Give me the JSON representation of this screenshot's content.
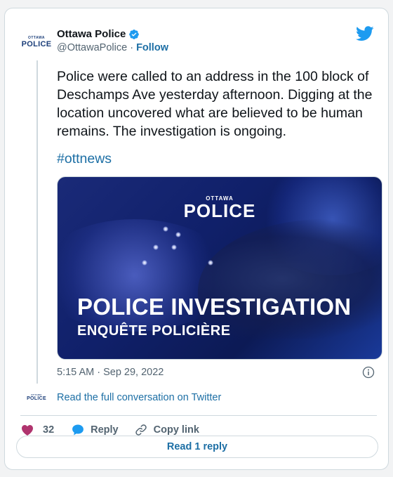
{
  "author": {
    "name": "Ottawa Police",
    "handle": "@OttawaPolice",
    "separator": "·",
    "follow_label": "Follow",
    "logo_small": "OTTAWA",
    "logo_main": "POLICE"
  },
  "tweet": {
    "text": "Police were called to an address in the 100 block of Deschamps Ave yesterday afternoon. Digging at the location uncovered what are believed to be human remains. The investigation is ongoing.",
    "hashtag": "#ottnews",
    "timestamp": "5:15 AM · Sep 29, 2022"
  },
  "media": {
    "logo_small": "OTTAWA",
    "logo_main": "POLICE",
    "title": "POLICE INVESTIGATION",
    "subtitle": "ENQUÊTE POLICIÈRE"
  },
  "conversation": {
    "link_text": "Read the full conversation on Twitter"
  },
  "actions": {
    "like_count": "32",
    "reply_label": "Reply",
    "copy_label": "Copy link"
  },
  "footer": {
    "read_replies_label": "Read 1 reply"
  },
  "colors": {
    "accent": "#1d6fa5",
    "heart": "#b0346e",
    "verified": "#1d9bf0",
    "twitter": "#1d9bf0"
  },
  "icons": {
    "verified": "verified-badge-icon",
    "twitter": "twitter-bird-icon",
    "info": "info-icon",
    "like": "heart-icon",
    "reply": "speech-bubble-icon",
    "copy": "link-icon"
  }
}
